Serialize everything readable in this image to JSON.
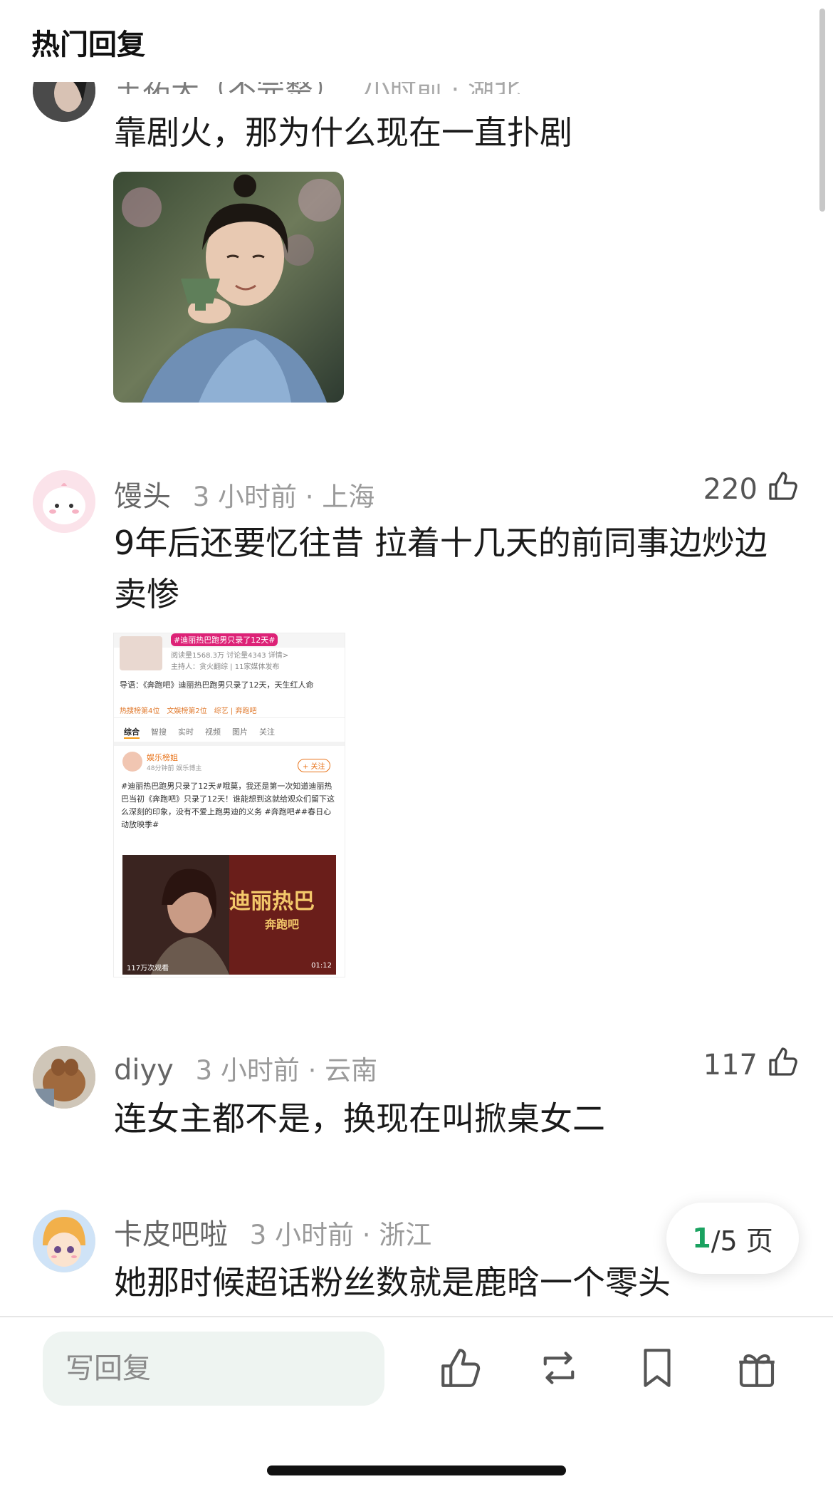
{
  "header": {
    "title": "热门回复"
  },
  "comments": [
    {
      "name": "王祐天（不完整）",
      "time": "小时前 · 湖北",
      "likes": "",
      "text": "靠剧火，那为什么现在一直扑剧",
      "image": "drama-still"
    },
    {
      "name": "馒头",
      "time": "3 小时前 · 上海",
      "likes": "220",
      "text": "9年后还要忆往昔 拉着十几天的前同事边炒边卖惨",
      "image": "weibo-screenshot"
    },
    {
      "name": "diyy",
      "time": "3 小时前 · 云南",
      "likes": "117",
      "text": "连女主都不是，换现在叫掀桌女二"
    },
    {
      "name": "卡皮吧啦",
      "time": "3 小时前 · 浙江",
      "likes": "",
      "text": "她那时候超话粉丝数就是鹿晗一个零头"
    }
  ],
  "screenshot": {
    "topic": "#迪丽热巴跑男只录了12天#",
    "stats": "阅读量1568.3万  讨论量4343  详情>",
    "host": "主持人：贪火翻综 | 11家媒体发布",
    "intro": "导语：《奔跑吧》迪丽热巴跑男只录了12天，天生红人命",
    "tags": [
      "热搜榜第4位",
      "文娱榜第2位",
      "综艺 | 奔跑吧"
    ],
    "tabs": [
      "综合",
      "智搜",
      "实时",
      "视频",
      "图片",
      "关注"
    ],
    "poster_name": "娱乐榜姐",
    "poster_meta": "48分钟前  娱乐博主",
    "follow": "+ 关注",
    "post_text": "#迪丽热巴跑男只录了12天#哦莫，我还是第一次知道迪丽热巴当初《奔跑吧》只录了12天！谁能想到这就给观众们留下这么深刻的印象，没有不爱上跑男迪的义务 #奔跑吧##春日心动放映季#",
    "video_title": "迪丽热巴",
    "video_sub": "奔跑吧",
    "video_views": "117万次观看",
    "video_duration": "01:12"
  },
  "pager": {
    "current": "1",
    "total": "/5 页"
  },
  "reply_placeholder": "写回复",
  "toolbar_icons": [
    "thumb-up-icon",
    "repost-icon",
    "bookmark-icon",
    "gift-icon"
  ]
}
